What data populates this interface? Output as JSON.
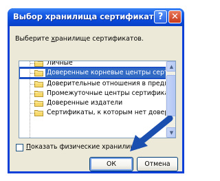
{
  "window": {
    "title": "Выбор хранилища сертификата",
    "help_glyph": "?",
    "close_glyph": "✕"
  },
  "dialog": {
    "prompt_pre": "Выберите ",
    "prompt_underlined": "х",
    "prompt_post": "ранилище сертификатов."
  },
  "tree": {
    "items": [
      {
        "label": "Личные",
        "selected": false
      },
      {
        "label": "Доверенные корневые центры сертиф",
        "selected": true
      },
      {
        "label": "Доверительные отношения в предпри",
        "selected": false
      },
      {
        "label": "Промежуточные центры сертификаци",
        "selected": false
      },
      {
        "label": "Доверенные издатели",
        "selected": false
      },
      {
        "label": "Сертификаты, к которым нет доверия",
        "selected": false
      }
    ],
    "scroll_up_glyph": "▲",
    "scroll_down_glyph": "▼"
  },
  "options": {
    "show_physical_underlined": "П",
    "show_physical_rest": "оказать физические хранилища",
    "show_physical_checked": false
  },
  "buttons": {
    "ok_label": "ОК",
    "cancel_label": "Отмена"
  },
  "colors": {
    "titlebar": "#0a49d8",
    "selection": "#316ac5",
    "dialog_bg": "#ece9d8",
    "arrow": "#1a4fb0"
  }
}
